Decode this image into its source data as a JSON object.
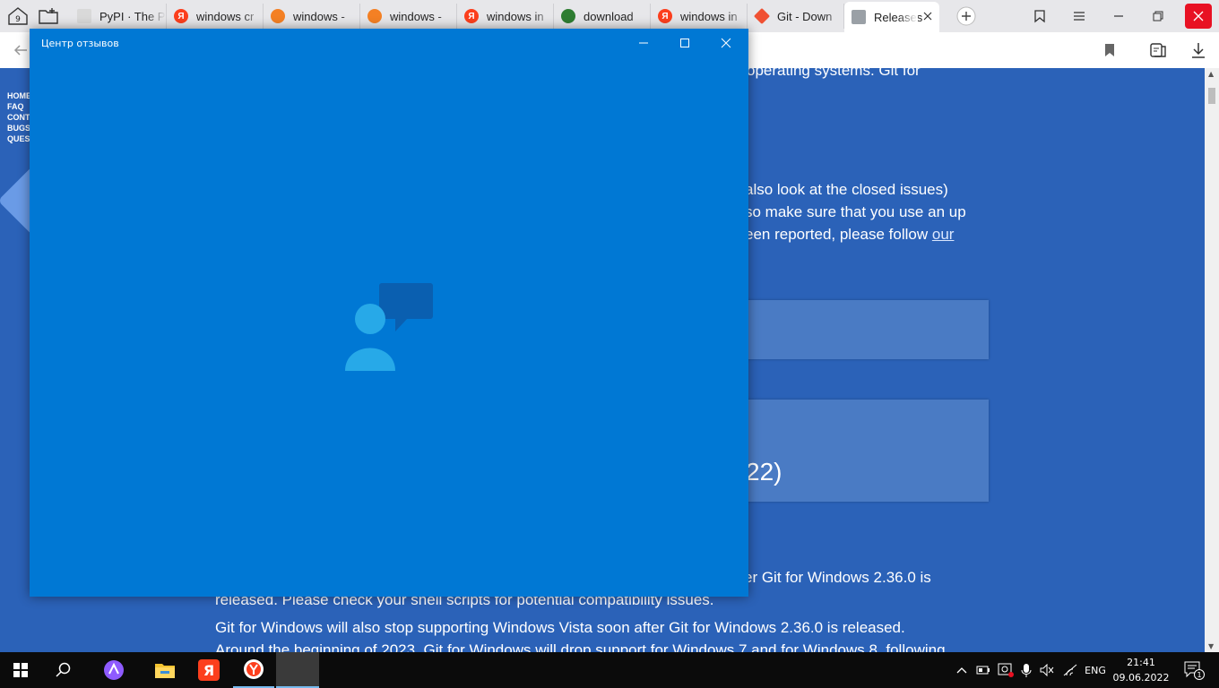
{
  "browser": {
    "tab_count_badge": "9",
    "tabs": [
      {
        "title": "PyPI · The P",
        "icon": "pypi-icon",
        "color": "#d9d9d9"
      },
      {
        "title": "windows cr",
        "icon": "yandex-icon",
        "color": "#fc3f1d"
      },
      {
        "title": "windows -",
        "icon": "stackoverflow-icon",
        "color": "#f48024"
      },
      {
        "title": "windows -",
        "icon": "stackoverflow-icon",
        "color": "#f48024"
      },
      {
        "title": "windows in",
        "icon": "yandex-icon",
        "color": "#fc3f1d"
      },
      {
        "title": "download",
        "icon": "gear-icon",
        "color": "#2e7d32"
      },
      {
        "title": "windows in",
        "icon": "yandex-icon",
        "color": "#fc3f1d"
      },
      {
        "title": "Git - Down",
        "icon": "git-icon",
        "color": "#f05133"
      },
      {
        "title": "Releases",
        "icon": "document-icon",
        "color": "#9aa0a6",
        "active": true
      }
    ]
  },
  "page": {
    "sidenav": [
      "HOME",
      "FAQ",
      "CONT",
      "BUGS",
      "QUES"
    ],
    "line_top": "operating systems. Git for",
    "para1_line1": "also look at the closed issues)",
    "para1_line2": "so make sure that you use an up",
    "para1_line3": "een reported, please follow",
    "para1_link": "our",
    "box_heading_partial": "22)",
    "bottom_line1": "er Git for Windows 2.36.0 is",
    "bottom_line2": "released. Please check your shell scripts for potential compatibility issues.",
    "bottom_line3": "Git for Windows will also stop supporting Windows Vista soon after Git for Windows 2.36.0 is released.",
    "bottom_line4": "Around the beginning of 2023, Git for Windows will drop support for Windows 7 and for Windows 8, following"
  },
  "window": {
    "title": "Центр отзывов",
    "background": "#0078d4"
  },
  "taskbar": {
    "language": "ENG",
    "time": "21:41",
    "date": "09.06.2022",
    "notification_count": "1"
  }
}
